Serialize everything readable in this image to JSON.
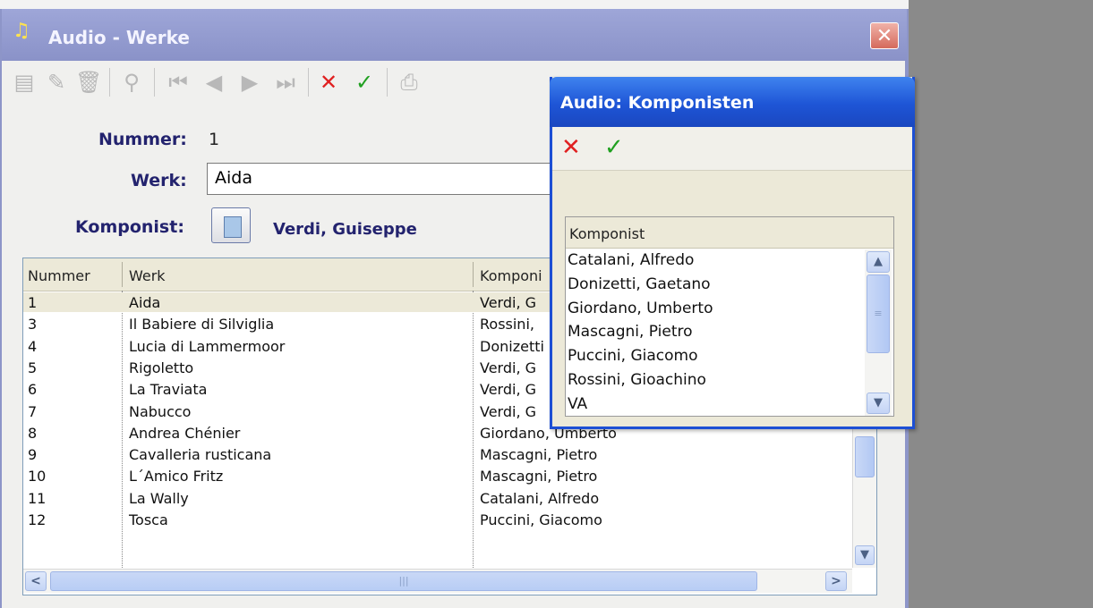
{
  "main": {
    "title": "Audio - Werke",
    "icons": {
      "app": "music-note-icon",
      "close": "close-icon"
    },
    "fields": {
      "nummer_label": "Nummer:",
      "nummer_value": "1",
      "werk_label": "Werk:",
      "werk_value": "Aida",
      "komponist_label": "Komponist:",
      "komponist_value": "Verdi, Guiseppe"
    },
    "grid": {
      "headers": [
        "Nummer",
        "Werk",
        "Komponi"
      ],
      "rows": [
        {
          "nummer": "1",
          "werk": "Aida",
          "komponist": "Verdi, G"
        },
        {
          "nummer": "3",
          "werk": "Il Babiere di Silviglia",
          "komponist": "Rossini,"
        },
        {
          "nummer": "4",
          "werk": "Lucia di Lammermoor",
          "komponist": "Donizetti"
        },
        {
          "nummer": "5",
          "werk": "Rigoletto",
          "komponist": "Verdi, G"
        },
        {
          "nummer": "6",
          "werk": "La Traviata",
          "komponist": "Verdi, G"
        },
        {
          "nummer": "7",
          "werk": "Nabucco",
          "komponist": "Verdi, G"
        },
        {
          "nummer": "8",
          "werk": "Andrea Chénier",
          "komponist": "Giordano, Umberto"
        },
        {
          "nummer": "9",
          "werk": "Cavalleria rusticana",
          "komponist": "Mascagni, Pietro"
        },
        {
          "nummer": "10",
          "werk": "L´Amico Fritz",
          "komponist": "Mascagni, Pietro"
        },
        {
          "nummer": "11",
          "werk": "La Wally",
          "komponist": "Catalani, Alfredo"
        },
        {
          "nummer": "12",
          "werk": "Tosca",
          "komponist": "Puccini, Giacomo"
        }
      ]
    }
  },
  "dialog": {
    "title": "Audio: Komponisten",
    "list_header": "Komponist",
    "items": [
      "Catalani, Alfredo",
      "Donizetti, Gaetano",
      "Giordano, Umberto",
      "Mascagni, Pietro",
      "Puccini, Giacomo",
      "Rossini, Gioachino",
      "VA"
    ]
  },
  "colors": {
    "label": "#23236e",
    "title_bar": "#8a92c8",
    "dialog_title": "#1e55d6"
  }
}
